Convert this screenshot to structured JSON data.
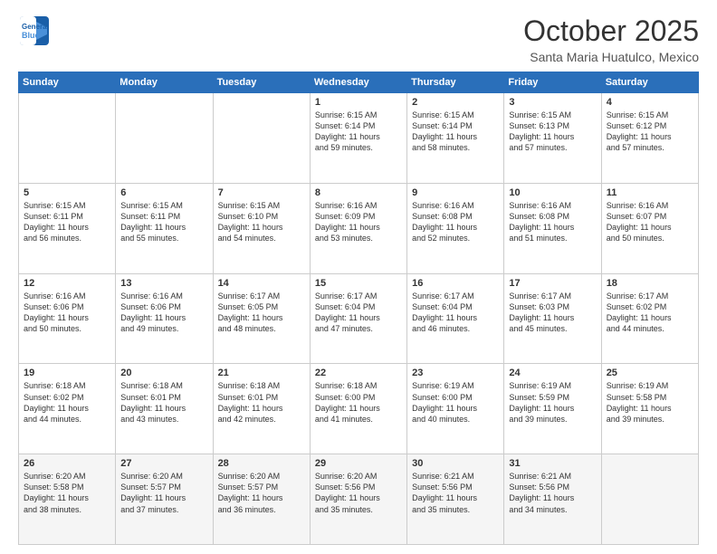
{
  "header": {
    "logo_line1": "General",
    "logo_line2": "Blue",
    "month": "October 2025",
    "location": "Santa Maria Huatulco, Mexico"
  },
  "weekdays": [
    "Sunday",
    "Monday",
    "Tuesday",
    "Wednesday",
    "Thursday",
    "Friday",
    "Saturday"
  ],
  "weeks": [
    [
      {
        "day": "",
        "info": ""
      },
      {
        "day": "",
        "info": ""
      },
      {
        "day": "",
        "info": ""
      },
      {
        "day": "1",
        "info": "Sunrise: 6:15 AM\nSunset: 6:14 PM\nDaylight: 11 hours\nand 59 minutes."
      },
      {
        "day": "2",
        "info": "Sunrise: 6:15 AM\nSunset: 6:14 PM\nDaylight: 11 hours\nand 58 minutes."
      },
      {
        "day": "3",
        "info": "Sunrise: 6:15 AM\nSunset: 6:13 PM\nDaylight: 11 hours\nand 57 minutes."
      },
      {
        "day": "4",
        "info": "Sunrise: 6:15 AM\nSunset: 6:12 PM\nDaylight: 11 hours\nand 57 minutes."
      }
    ],
    [
      {
        "day": "5",
        "info": "Sunrise: 6:15 AM\nSunset: 6:11 PM\nDaylight: 11 hours\nand 56 minutes."
      },
      {
        "day": "6",
        "info": "Sunrise: 6:15 AM\nSunset: 6:11 PM\nDaylight: 11 hours\nand 55 minutes."
      },
      {
        "day": "7",
        "info": "Sunrise: 6:15 AM\nSunset: 6:10 PM\nDaylight: 11 hours\nand 54 minutes."
      },
      {
        "day": "8",
        "info": "Sunrise: 6:16 AM\nSunset: 6:09 PM\nDaylight: 11 hours\nand 53 minutes."
      },
      {
        "day": "9",
        "info": "Sunrise: 6:16 AM\nSunset: 6:08 PM\nDaylight: 11 hours\nand 52 minutes."
      },
      {
        "day": "10",
        "info": "Sunrise: 6:16 AM\nSunset: 6:08 PM\nDaylight: 11 hours\nand 51 minutes."
      },
      {
        "day": "11",
        "info": "Sunrise: 6:16 AM\nSunset: 6:07 PM\nDaylight: 11 hours\nand 50 minutes."
      }
    ],
    [
      {
        "day": "12",
        "info": "Sunrise: 6:16 AM\nSunset: 6:06 PM\nDaylight: 11 hours\nand 50 minutes."
      },
      {
        "day": "13",
        "info": "Sunrise: 6:16 AM\nSunset: 6:06 PM\nDaylight: 11 hours\nand 49 minutes."
      },
      {
        "day": "14",
        "info": "Sunrise: 6:17 AM\nSunset: 6:05 PM\nDaylight: 11 hours\nand 48 minutes."
      },
      {
        "day": "15",
        "info": "Sunrise: 6:17 AM\nSunset: 6:04 PM\nDaylight: 11 hours\nand 47 minutes."
      },
      {
        "day": "16",
        "info": "Sunrise: 6:17 AM\nSunset: 6:04 PM\nDaylight: 11 hours\nand 46 minutes."
      },
      {
        "day": "17",
        "info": "Sunrise: 6:17 AM\nSunset: 6:03 PM\nDaylight: 11 hours\nand 45 minutes."
      },
      {
        "day": "18",
        "info": "Sunrise: 6:17 AM\nSunset: 6:02 PM\nDaylight: 11 hours\nand 44 minutes."
      }
    ],
    [
      {
        "day": "19",
        "info": "Sunrise: 6:18 AM\nSunset: 6:02 PM\nDaylight: 11 hours\nand 44 minutes."
      },
      {
        "day": "20",
        "info": "Sunrise: 6:18 AM\nSunset: 6:01 PM\nDaylight: 11 hours\nand 43 minutes."
      },
      {
        "day": "21",
        "info": "Sunrise: 6:18 AM\nSunset: 6:01 PM\nDaylight: 11 hours\nand 42 minutes."
      },
      {
        "day": "22",
        "info": "Sunrise: 6:18 AM\nSunset: 6:00 PM\nDaylight: 11 hours\nand 41 minutes."
      },
      {
        "day": "23",
        "info": "Sunrise: 6:19 AM\nSunset: 6:00 PM\nDaylight: 11 hours\nand 40 minutes."
      },
      {
        "day": "24",
        "info": "Sunrise: 6:19 AM\nSunset: 5:59 PM\nDaylight: 11 hours\nand 39 minutes."
      },
      {
        "day": "25",
        "info": "Sunrise: 6:19 AM\nSunset: 5:58 PM\nDaylight: 11 hours\nand 39 minutes."
      }
    ],
    [
      {
        "day": "26",
        "info": "Sunrise: 6:20 AM\nSunset: 5:58 PM\nDaylight: 11 hours\nand 38 minutes."
      },
      {
        "day": "27",
        "info": "Sunrise: 6:20 AM\nSunset: 5:57 PM\nDaylight: 11 hours\nand 37 minutes."
      },
      {
        "day": "28",
        "info": "Sunrise: 6:20 AM\nSunset: 5:57 PM\nDaylight: 11 hours\nand 36 minutes."
      },
      {
        "day": "29",
        "info": "Sunrise: 6:20 AM\nSunset: 5:56 PM\nDaylight: 11 hours\nand 35 minutes."
      },
      {
        "day": "30",
        "info": "Sunrise: 6:21 AM\nSunset: 5:56 PM\nDaylight: 11 hours\nand 35 minutes."
      },
      {
        "day": "31",
        "info": "Sunrise: 6:21 AM\nSunset: 5:56 PM\nDaylight: 11 hours\nand 34 minutes."
      },
      {
        "day": "",
        "info": ""
      }
    ]
  ]
}
